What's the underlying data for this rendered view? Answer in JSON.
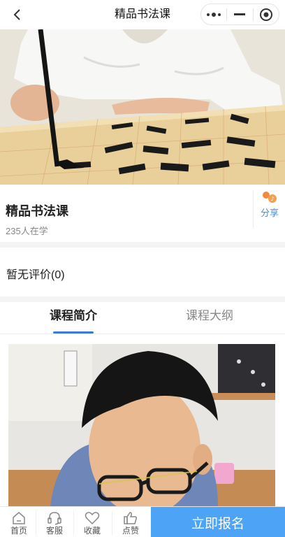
{
  "navbar": {
    "title": "精品书法课",
    "back_icon": "chevron-left-icon",
    "capsule_icons": [
      "more-dots-icon",
      "minimize-icon",
      "close-target-icon"
    ]
  },
  "course": {
    "title": "精品书法课",
    "learners": "235人在学",
    "share_label": "分享"
  },
  "review": {
    "text": "暂无评价(0)"
  },
  "tabs": {
    "items": [
      {
        "label": "课程简介",
        "active": true
      },
      {
        "label": "课程大纲",
        "active": false
      }
    ]
  },
  "bottom_bar": {
    "items": [
      {
        "label": "首页",
        "icon": "home-icon"
      },
      {
        "label": "客服",
        "icon": "headset-icon"
      },
      {
        "label": "收藏",
        "icon": "heart-icon"
      },
      {
        "label": "点赞",
        "icon": "thumbs-up-icon"
      }
    ],
    "signup_label": "立即报名"
  },
  "colors": {
    "accent": "#3a7bd5",
    "signup_bg": "#4da3f5",
    "share_text": "#4a90d9"
  }
}
